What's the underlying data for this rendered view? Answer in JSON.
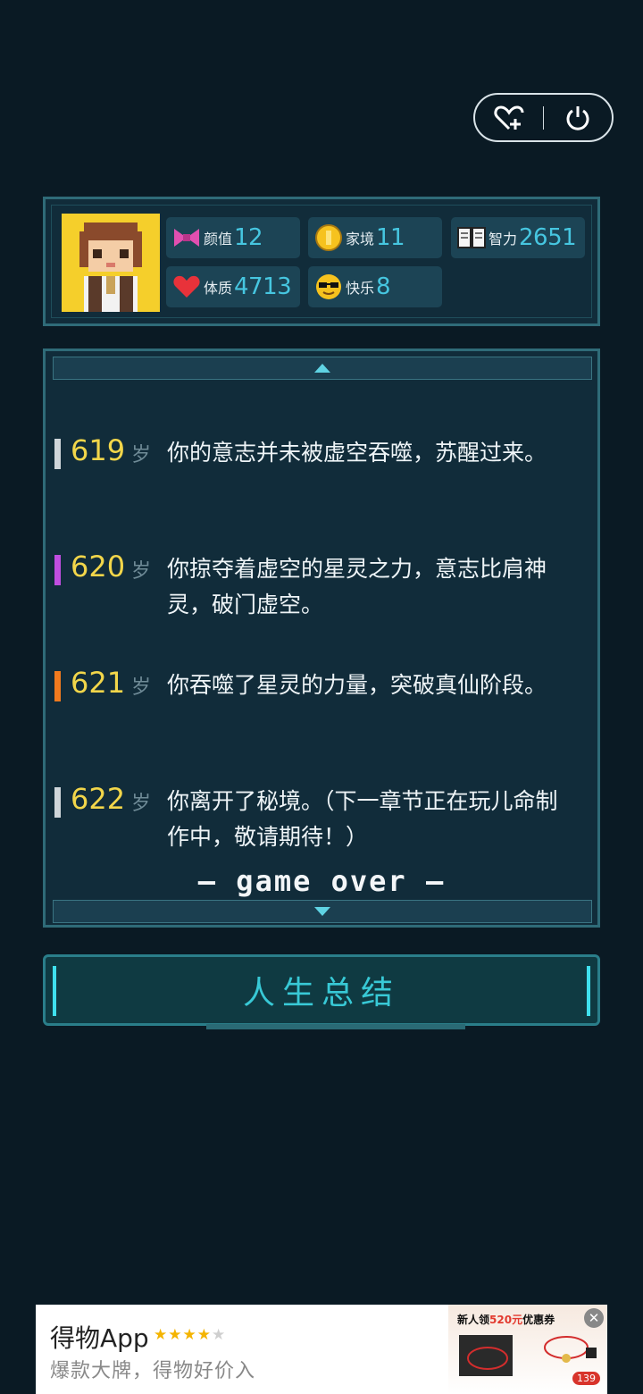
{
  "top_controls": {
    "favorite_icon": "heart-plus-icon",
    "power_icon": "power-icon"
  },
  "stats": {
    "appearance": {
      "label": "颜值",
      "value": "12",
      "icon": "bow-icon"
    },
    "family": {
      "label": "家境",
      "value": "11",
      "icon": "coin-icon"
    },
    "intelligence": {
      "label": "智力",
      "value": "2651",
      "icon": "book-icon"
    },
    "physique": {
      "label": "体质",
      "value": "4713",
      "icon": "heart-icon"
    },
    "happiness": {
      "label": "快乐",
      "value": "8",
      "icon": "sunglasses-icon"
    }
  },
  "log": {
    "entries": [
      {
        "age": "619",
        "unit": "岁",
        "text": "你的意志并未被虚空吞噬，苏醒过来。",
        "bar_color": "#cfd6da"
      },
      {
        "age": "620",
        "unit": "岁",
        "text": "你掠夺着虚空的星灵之力，意志比肩神灵，破门虚空。",
        "bar_color": "#c04ee0"
      },
      {
        "age": "621",
        "unit": "岁",
        "text": "你吞噬了星灵的力量，突破真仙阶段。",
        "bar_color": "#f07a1e"
      },
      {
        "age": "622",
        "unit": "岁",
        "text": "你离开了秘境。（下一章节正在玩儿命制作中，敬请期待！）",
        "bar_color": "#cfd6da"
      }
    ],
    "end_text": "— game over —"
  },
  "summary_button": {
    "label": "人生总结"
  },
  "ad": {
    "title": "得物App",
    "rating_stars": 4,
    "rating_max": 5,
    "subtitle": "爆款大牌，得物好价入",
    "promo_prefix": "新人领",
    "promo_highlight": "520元",
    "promo_suffix": "优惠券",
    "price": "139"
  }
}
